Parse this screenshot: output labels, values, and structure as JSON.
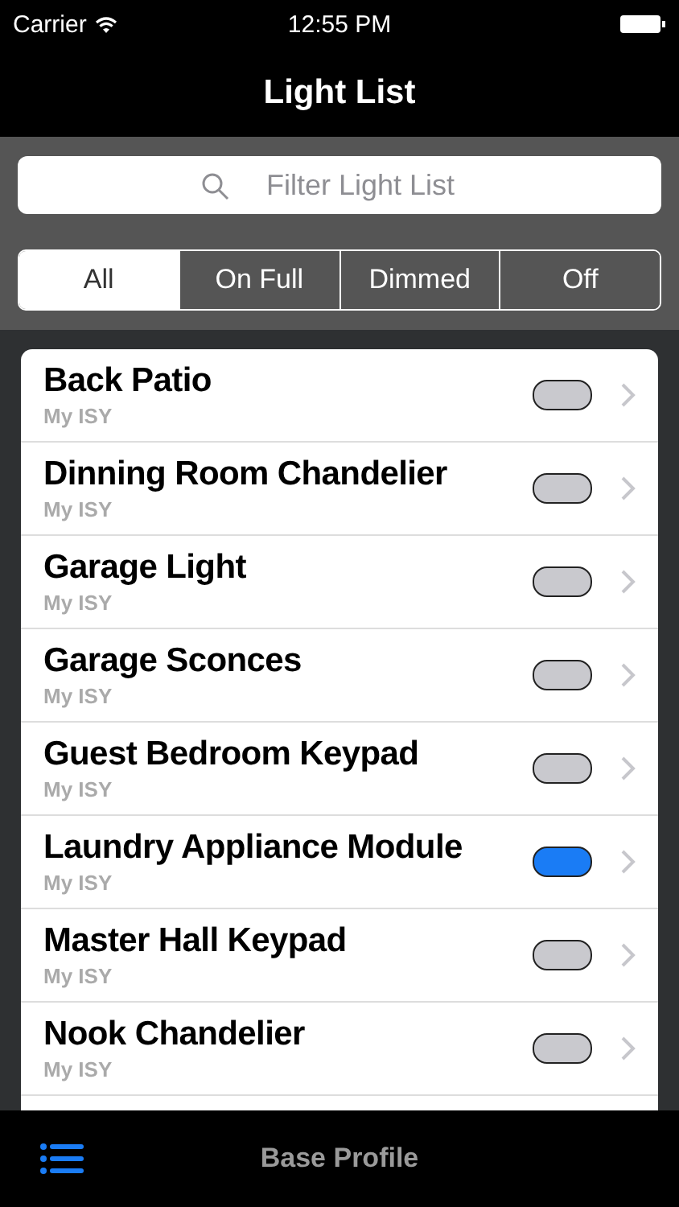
{
  "status_bar": {
    "carrier": "Carrier",
    "time": "12:55 PM"
  },
  "nav_bar": {
    "title": "Light List"
  },
  "search": {
    "placeholder": "Filter Light List"
  },
  "filter_tabs": [
    {
      "label": "All",
      "selected": true
    },
    {
      "label": "On Full",
      "selected": false
    },
    {
      "label": "Dimmed",
      "selected": false
    },
    {
      "label": "Off",
      "selected": false
    }
  ],
  "lights": [
    {
      "name": "Back Patio",
      "subtitle": "My ISY",
      "on": false
    },
    {
      "name": "Dinning Room Chandelier",
      "subtitle": "My ISY",
      "on": false
    },
    {
      "name": "Garage Light",
      "subtitle": "My ISY",
      "on": false
    },
    {
      "name": "Garage Sconces",
      "subtitle": "My ISY",
      "on": false
    },
    {
      "name": "Guest Bedroom Keypad",
      "subtitle": "My ISY",
      "on": false
    },
    {
      "name": "Laundry Appliance Module",
      "subtitle": "My ISY",
      "on": true
    },
    {
      "name": "Master Hall Keypad",
      "subtitle": "My ISY",
      "on": false
    },
    {
      "name": "Nook Chandelier",
      "subtitle": "My ISY",
      "on": false
    }
  ],
  "toolbar": {
    "title": "Base Profile"
  }
}
